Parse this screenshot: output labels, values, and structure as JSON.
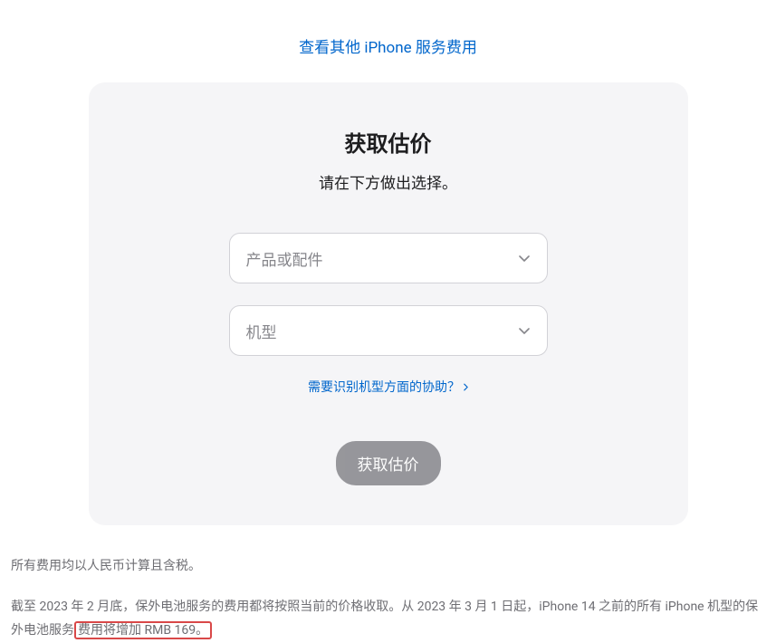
{
  "topLink": "查看其他 iPhone 服务费用",
  "card": {
    "title": "获取估价",
    "subtitle": "请在下方做出选择。",
    "select1": {
      "placeholder": "产品或配件"
    },
    "select2": {
      "placeholder": "机型"
    },
    "helpLink": "需要识别机型方面的协助？",
    "button": "获取估价"
  },
  "footer": {
    "line1": "所有费用均以人民币计算且含税。",
    "line2_a": "截至 2023 年 2 月底，保外电池服务的费用都将按照当前的价格收取。从 2023 年 3 月 1 日起，iPhone 14 之前的所有 iPhone 机型的保外电池服务",
    "line2_b": "费用将增加 RMB 169。"
  }
}
